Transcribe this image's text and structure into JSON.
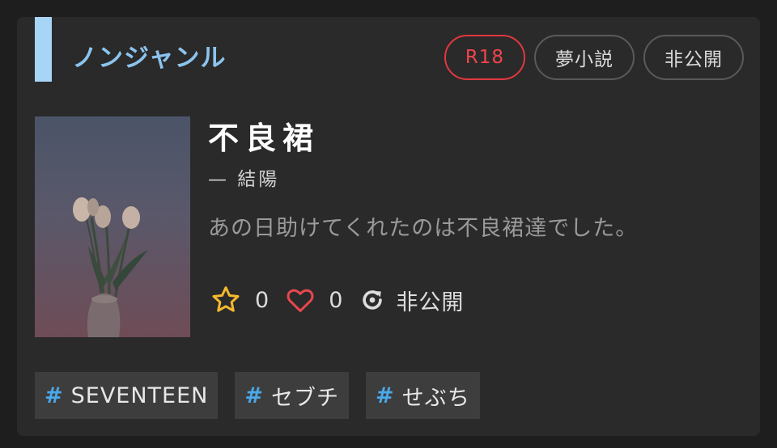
{
  "genre": "ノンジャンル",
  "badges": {
    "rating": "R18",
    "category": "夢小説",
    "visibility": "非公開"
  },
  "work": {
    "title": "不良裙",
    "author": "— 結陽",
    "description": "あの日助けてくれたのは不良裙達でした。"
  },
  "stats": {
    "stars": "0",
    "likes": "0",
    "status": "非公開"
  },
  "tags": [
    {
      "hash": "#",
      "label": "SEVENTEEN"
    },
    {
      "hash": "#",
      "label": "セブチ"
    },
    {
      "hash": "#",
      "label": "せぶち"
    }
  ],
  "colors": {
    "accent": "#8cc4ee",
    "r18": "#e2373f",
    "star": "#f5b82e",
    "heart": "#e8474f",
    "tag_hash": "#4aa8ea"
  },
  "icons": {
    "star": "star-icon",
    "heart": "heart-icon",
    "refresh": "refresh-icon"
  }
}
